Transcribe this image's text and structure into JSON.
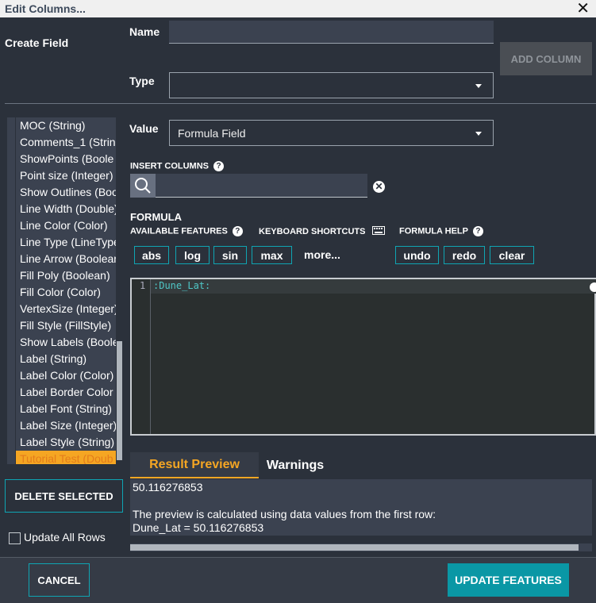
{
  "window": {
    "title": "Edit Columns...",
    "close_glyph": "✕"
  },
  "create_field": {
    "heading": "Create Field",
    "name_label": "Name",
    "name_value": "",
    "type_label": "Type",
    "type_value": "",
    "add_column_label": "ADD COLUMN"
  },
  "columns_list": {
    "items": [
      "MOC (String)",
      "Comments_1 (Strin",
      "ShowPoints (Boole",
      "Point size (Integer)",
      "Show Outlines (Boo",
      "Line Width (Double)",
      "Line Color (Color)",
      "Line Type (LineType",
      "Line Arrow (Boolear",
      "Fill Poly (Boolean)",
      "Fill Color (Color)",
      "VertexSize (Integer)",
      "Fill Style (FillStyle)",
      "Show Labels (Boole",
      "Label (String)",
      "Label Color (Color)",
      "Label Border Color",
      "Label Font (String)",
      "Label Size (Integer)",
      "Label Style (String)",
      "Tutorial Test (Doub"
    ],
    "selected_index": 20,
    "delete_label": "DELETE SELECTED",
    "update_all_label": "Update All Rows"
  },
  "value": {
    "label": "Value",
    "selected": "Formula Field"
  },
  "insert_columns": {
    "label": "INSERT COLUMNS",
    "search_value": ""
  },
  "formula": {
    "heading": "FORMULA",
    "available_features_label": "AVAILABLE FEATURES",
    "keyboard_shortcuts_label": "KEYBOARD SHORTCUTS",
    "formula_help_label": "FORMULA HELP",
    "functions": [
      "abs",
      "log",
      "sin",
      "max"
    ],
    "more_label": "more...",
    "undo_label": "undo",
    "redo_label": "redo",
    "clear_label": "clear",
    "line_number": "1",
    "code": ":Dune_Lat:"
  },
  "tabs": {
    "result_preview": "Result Preview",
    "warnings": "Warnings"
  },
  "preview": {
    "result": "50.116276853",
    "note": "The preview is calculated using data values from the first row:",
    "detail": "Dune_Lat = 50.116276853"
  },
  "footer": {
    "cancel_label": "CANCEL",
    "update_label": "UPDATE  FEATURES"
  },
  "colors": {
    "accent_teal": "#0a97a5",
    "accent_orange": "#f5a623",
    "background": "#2b313b"
  }
}
